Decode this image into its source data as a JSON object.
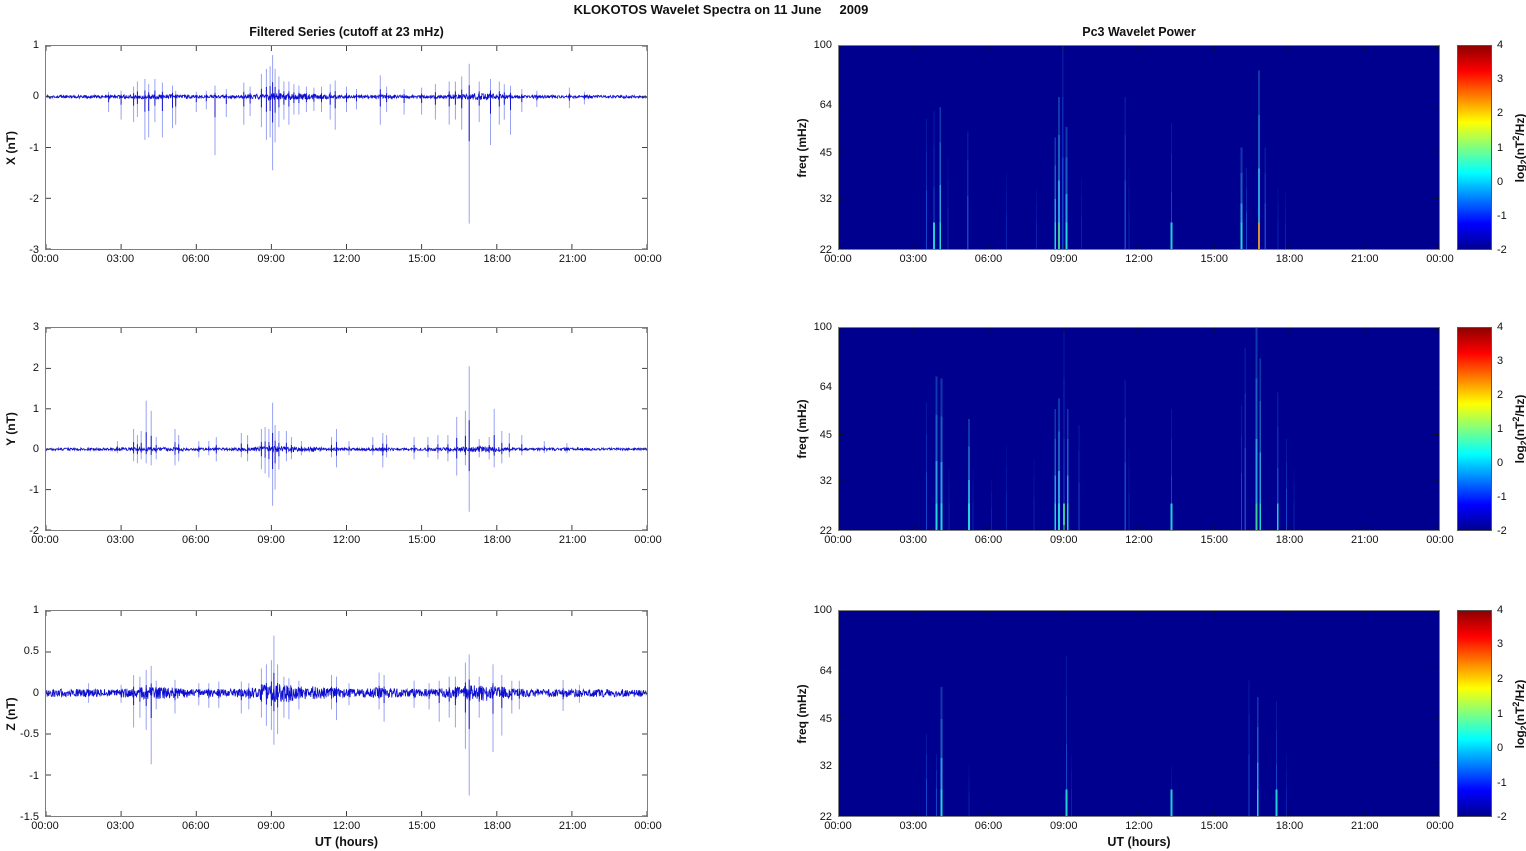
{
  "figure_title": "KLOKOTOS Wavelet Spectra on 11 June     2009",
  "colorbar": {
    "ticks": [
      4,
      3,
      2,
      1,
      0,
      -1,
      -2
    ],
    "range": [
      -2,
      4
    ],
    "label_prefix": "log",
    "label_sub": "2",
    "label_mid": "(nT",
    "label_sup": "2",
    "label_suffix": "/Hz)",
    "jet_stops": [
      [
        "#000090",
        0
      ],
      [
        "#0000ff",
        12.5
      ],
      [
        "#00ffff",
        37.5
      ],
      [
        "#ffff00",
        62.5
      ],
      [
        "#ff0000",
        87.5
      ],
      [
        "#900000",
        100
      ]
    ]
  },
  "chart_data": [
    {
      "type": "line",
      "title": "Filtered Series (cutoff at 23 mHz)",
      "ylabel": "X (nT)",
      "xlabel": "",
      "x_ticks": [
        "00:00",
        "03:00",
        "06:00",
        "09:00",
        "12:00",
        "15:00",
        "18:00",
        "21:00",
        "00:00"
      ],
      "x_range_hours": [
        0,
        24
      ],
      "y_ticks": [
        1,
        0,
        -1,
        -2,
        -3
      ],
      "ylim": [
        -3,
        1
      ],
      "line_color": "#0000cc",
      "spike_color": "#4658e8",
      "noise_amplitude": 0.03,
      "spikes": [
        [
          2.5,
          0.1,
          -0.3
        ],
        [
          3.0,
          0.12,
          -0.45
        ],
        [
          3.5,
          0.2,
          -0.5
        ],
        [
          3.65,
          0.3,
          -0.4
        ],
        [
          3.95,
          0.35,
          -0.85
        ],
        [
          4.1,
          0.25,
          -0.8
        ],
        [
          4.35,
          0.35,
          -0.5
        ],
        [
          4.65,
          0.28,
          -0.8
        ],
        [
          5.05,
          0.22,
          -0.62
        ],
        [
          5.18,
          0.12,
          -0.55
        ],
        [
          6.0,
          0.1,
          -0.3
        ],
        [
          6.4,
          0.12,
          -0.25
        ],
        [
          6.75,
          0.22,
          -1.15
        ],
        [
          7.2,
          0.15,
          -0.4
        ],
        [
          7.9,
          0.28,
          -0.55
        ],
        [
          8.15,
          0.2,
          -0.38
        ],
        [
          8.6,
          0.45,
          -0.6
        ],
        [
          8.8,
          0.55,
          -0.85
        ],
        [
          8.95,
          0.6,
          -0.8
        ],
        [
          9.05,
          0.82,
          -1.45
        ],
        [
          9.15,
          0.55,
          -0.9
        ],
        [
          9.3,
          0.4,
          -0.6
        ],
        [
          9.5,
          0.3,
          -0.45
        ],
        [
          9.7,
          0.3,
          -0.55
        ],
        [
          9.9,
          0.25,
          -0.35
        ],
        [
          10.1,
          0.22,
          -0.35
        ],
        [
          10.4,
          0.2,
          -0.3
        ],
        [
          10.7,
          0.18,
          -0.28
        ],
        [
          11.0,
          0.2,
          -0.3
        ],
        [
          11.35,
          0.25,
          -0.45
        ],
        [
          11.55,
          0.32,
          -0.65
        ],
        [
          12.0,
          0.2,
          -0.3
        ],
        [
          12.4,
          0.15,
          -0.25
        ],
        [
          13.35,
          0.42,
          -0.55
        ],
        [
          13.6,
          0.2,
          -0.3
        ],
        [
          14.3,
          0.15,
          -0.35
        ],
        [
          15.0,
          0.18,
          -0.35
        ],
        [
          15.55,
          0.25,
          -0.45
        ],
        [
          16.1,
          0.3,
          -0.55
        ],
        [
          16.35,
          0.3,
          -0.45
        ],
        [
          16.6,
          0.4,
          -0.65
        ],
        [
          16.9,
          0.65,
          -2.5
        ],
        [
          17.3,
          0.3,
          -0.5
        ],
        [
          17.75,
          0.35,
          -0.95
        ],
        [
          18.1,
          0.3,
          -0.55
        ],
        [
          18.3,
          0.25,
          -0.45
        ],
        [
          18.55,
          0.22,
          -0.75
        ],
        [
          19.0,
          0.15,
          -0.3
        ],
        [
          19.6,
          0.12,
          -0.2
        ],
        [
          20.9,
          0.18,
          -0.22
        ],
        [
          21.5,
          0.1,
          -0.15
        ]
      ]
    },
    {
      "type": "heatmap",
      "title": "Pc3 Wavelet Power",
      "ylabel": "freq (mHz)",
      "xlabel": "",
      "x_ticks": [
        "00:00",
        "03:00",
        "06:00",
        "09:00",
        "12:00",
        "15:00",
        "18:00",
        "21:00",
        "00:00"
      ],
      "x_range_hours": [
        0,
        24
      ],
      "y_ticks": [
        100,
        64,
        45,
        32,
        22
      ],
      "ylim_mhz": [
        22,
        100
      ],
      "y_scale": "log",
      "bg_color": "#00008f",
      "colorbar_range": [
        -2,
        4
      ],
      "streaks": [
        [
          3.5,
          0.64,
          1,
          ""
        ],
        [
          3.8,
          0.68,
          1,
          "cyan"
        ],
        [
          4.05,
          0.7,
          2,
          "cyan"
        ],
        [
          4.35,
          0.45,
          0,
          ""
        ],
        [
          5.15,
          0.58,
          1,
          ""
        ],
        [
          6.7,
          0.38,
          0,
          ""
        ],
        [
          7.9,
          0.3,
          0,
          ""
        ],
        [
          8.65,
          0.55,
          2,
          "cyan"
        ],
        [
          8.8,
          0.75,
          2,
          "green"
        ],
        [
          8.95,
          1.0,
          1,
          ""
        ],
        [
          9.1,
          0.6,
          2,
          "cyan"
        ],
        [
          9.7,
          0.35,
          0,
          ""
        ],
        [
          11.45,
          0.75,
          1,
          ""
        ],
        [
          11.6,
          0.4,
          0,
          ""
        ],
        [
          13.3,
          0.62,
          1,
          "cyan"
        ],
        [
          16.1,
          0.5,
          2,
          "cyan"
        ],
        [
          16.3,
          0.4,
          1,
          ""
        ],
        [
          16.8,
          0.88,
          2,
          "orange"
        ],
        [
          17.05,
          0.5,
          1,
          ""
        ],
        [
          17.55,
          0.3,
          0,
          ""
        ],
        [
          17.85,
          0.28,
          0,
          ""
        ]
      ]
    },
    {
      "type": "line",
      "title": "",
      "ylabel": "Y (nT)",
      "xlabel": "",
      "x_ticks": [
        "00:00",
        "03:00",
        "06:00",
        "09:00",
        "12:00",
        "15:00",
        "18:00",
        "21:00",
        "00:00"
      ],
      "x_range_hours": [
        0,
        24
      ],
      "y_ticks": [
        3,
        2,
        1,
        0,
        -1,
        -2
      ],
      "ylim": [
        -2,
        3
      ],
      "line_color": "#0000cc",
      "spike_color": "#4658e8",
      "noise_amplitude": 0.032,
      "spikes": [
        [
          2.85,
          0.2,
          -0.1
        ],
        [
          3.5,
          0.5,
          -0.3
        ],
        [
          3.65,
          0.35,
          -0.35
        ],
        [
          3.8,
          0.45,
          -0.25
        ],
        [
          4.0,
          1.2,
          -0.35
        ],
        [
          4.2,
          0.95,
          -0.4
        ],
        [
          4.4,
          0.3,
          -0.25
        ],
        [
          5.15,
          0.5,
          -0.4
        ],
        [
          5.3,
          0.35,
          -0.3
        ],
        [
          6.1,
          0.2,
          -0.2
        ],
        [
          6.5,
          0.2,
          -0.15
        ],
        [
          6.8,
          0.3,
          -0.3
        ],
        [
          7.8,
          0.4,
          -0.2
        ],
        [
          8.05,
          0.35,
          -0.3
        ],
        [
          8.6,
          0.5,
          -0.5
        ],
        [
          8.75,
          0.55,
          -0.6
        ],
        [
          8.9,
          0.5,
          -0.7
        ],
        [
          9.05,
          1.15,
          -1.4
        ],
        [
          9.15,
          0.6,
          -1.0
        ],
        [
          9.3,
          0.45,
          -0.5
        ],
        [
          9.6,
          0.45,
          -0.3
        ],
        [
          9.8,
          0.3,
          -0.25
        ],
        [
          10.2,
          0.2,
          -0.15
        ],
        [
          11.4,
          0.3,
          -0.2
        ],
        [
          11.6,
          0.5,
          -0.45
        ],
        [
          12.1,
          0.2,
          -0.15
        ],
        [
          13.05,
          0.3,
          -0.15
        ],
        [
          13.45,
          0.4,
          -0.45
        ],
        [
          13.6,
          0.35,
          -0.2
        ],
        [
          14.7,
          0.3,
          -0.25
        ],
        [
          15.25,
          0.3,
          -0.2
        ],
        [
          15.65,
          0.35,
          -0.25
        ],
        [
          16.05,
          0.35,
          -0.3
        ],
        [
          16.4,
          0.8,
          -0.65
        ],
        [
          16.75,
          0.95,
          -0.4
        ],
        [
          16.9,
          2.05,
          -1.55
        ],
        [
          17.3,
          0.25,
          -0.2
        ],
        [
          17.7,
          0.3,
          -0.25
        ],
        [
          17.9,
          1.0,
          -0.45
        ],
        [
          18.2,
          0.45,
          -0.35
        ],
        [
          18.5,
          0.4,
          -0.2
        ],
        [
          19.0,
          0.35,
          -0.15
        ],
        [
          19.9,
          0.2,
          -0.1
        ],
        [
          20.8,
          0.15,
          -0.1
        ]
      ]
    },
    {
      "type": "heatmap",
      "title": "",
      "ylabel": "freq (mHz)",
      "xlabel": "",
      "x_ticks": [
        "00:00",
        "03:00",
        "06:00",
        "09:00",
        "12:00",
        "15:00",
        "18:00",
        "21:00",
        "00:00"
      ],
      "x_range_hours": [
        0,
        24
      ],
      "y_ticks": [
        100,
        64,
        45,
        32,
        22
      ],
      "ylim_mhz": [
        22,
        100
      ],
      "y_scale": "log",
      "bg_color": "#00008f",
      "colorbar_range": [
        -2,
        4
      ],
      "streaks": [
        [
          3.5,
          0.63,
          1,
          ""
        ],
        [
          3.9,
          0.76,
          2,
          "cyan"
        ],
        [
          4.1,
          0.75,
          2,
          "cyan"
        ],
        [
          4.4,
          0.3,
          0,
          ""
        ],
        [
          5.2,
          0.55,
          2,
          "cyan"
        ],
        [
          5.35,
          0.3,
          0,
          ""
        ],
        [
          6.1,
          0.25,
          0,
          ""
        ],
        [
          6.7,
          0.42,
          0,
          ""
        ],
        [
          7.8,
          0.35,
          0,
          ""
        ],
        [
          8.65,
          0.6,
          2,
          "cyan"
        ],
        [
          8.8,
          0.65,
          2,
          "cyan"
        ],
        [
          9.0,
          1.0,
          1,
          "green"
        ],
        [
          9.15,
          0.6,
          2,
          "cyan"
        ],
        [
          9.6,
          0.52,
          1,
          ""
        ],
        [
          11.45,
          0.74,
          1,
          ""
        ],
        [
          11.6,
          0.4,
          0,
          ""
        ],
        [
          13.3,
          0.6,
          1,
          "cyan"
        ],
        [
          16.1,
          0.62,
          1,
          ""
        ],
        [
          16.25,
          0.9,
          1,
          ""
        ],
        [
          16.7,
          1.0,
          2,
          "green"
        ],
        [
          16.85,
          0.85,
          2,
          "cyan"
        ],
        [
          17.55,
          0.68,
          1,
          "cyan"
        ],
        [
          17.9,
          0.45,
          1,
          ""
        ],
        [
          18.2,
          0.3,
          0,
          ""
        ]
      ]
    },
    {
      "type": "line",
      "title": "",
      "ylabel": "Z (nT)",
      "xlabel": "UT (hours)",
      "x_ticks": [
        "00:00",
        "03:00",
        "06:00",
        "09:00",
        "12:00",
        "15:00",
        "18:00",
        "21:00",
        "00:00"
      ],
      "x_range_hours": [
        0,
        24
      ],
      "y_ticks": [
        1,
        0.5,
        0,
        -0.5,
        -1,
        -1.5
      ],
      "ylim": [
        -1.5,
        1
      ],
      "line_color": "#0000cc",
      "spike_color": "#4658e8",
      "noise_amplitude": 0.048,
      "spikes": [
        [
          1.7,
          0.12,
          -0.12
        ],
        [
          3.0,
          0.1,
          -0.12
        ],
        [
          3.5,
          0.22,
          -0.42
        ],
        [
          3.75,
          0.2,
          -0.3
        ],
        [
          4.0,
          0.28,
          -0.45
        ],
        [
          4.2,
          0.33,
          -0.87
        ],
        [
          4.4,
          0.15,
          -0.2
        ],
        [
          5.15,
          0.16,
          -0.25
        ],
        [
          6.1,
          0.12,
          -0.15
        ],
        [
          6.5,
          0.12,
          -0.18
        ],
        [
          6.9,
          0.14,
          -0.18
        ],
        [
          7.8,
          0.14,
          -0.25
        ],
        [
          8.1,
          0.12,
          -0.2
        ],
        [
          8.6,
          0.3,
          -0.3
        ],
        [
          8.8,
          0.35,
          -0.4
        ],
        [
          9.0,
          0.4,
          -0.45
        ],
        [
          9.1,
          0.7,
          -0.63
        ],
        [
          9.25,
          0.35,
          -0.5
        ],
        [
          9.5,
          0.2,
          -0.3
        ],
        [
          9.7,
          0.18,
          -0.32
        ],
        [
          10.1,
          0.15,
          -0.2
        ],
        [
          11.4,
          0.22,
          -0.2
        ],
        [
          11.6,
          0.2,
          -0.33
        ],
        [
          12.1,
          0.12,
          -0.15
        ],
        [
          13.3,
          0.25,
          -0.2
        ],
        [
          13.5,
          0.22,
          -0.35
        ],
        [
          14.7,
          0.15,
          -0.18
        ],
        [
          15.3,
          0.12,
          -0.2
        ],
        [
          15.7,
          0.15,
          -0.35
        ],
        [
          16.1,
          0.2,
          -0.3
        ],
        [
          16.35,
          0.2,
          -0.42
        ],
        [
          16.75,
          0.37,
          -0.68
        ],
        [
          16.9,
          0.47,
          -1.25
        ],
        [
          17.3,
          0.2,
          -0.3
        ],
        [
          17.85,
          0.35,
          -0.72
        ],
        [
          18.2,
          0.22,
          -0.52
        ],
        [
          18.6,
          0.15,
          -0.25
        ],
        [
          18.9,
          0.15,
          -0.2
        ],
        [
          20.65,
          0.16,
          -0.22
        ],
        [
          21.3,
          0.1,
          -0.12
        ]
      ]
    },
    {
      "type": "heatmap",
      "title": "",
      "ylabel": "freq (mHz)",
      "xlabel": "UT (hours)",
      "x_ticks": [
        "00:00",
        "03:00",
        "06:00",
        "09:00",
        "12:00",
        "15:00",
        "18:00",
        "21:00",
        "00:00"
      ],
      "x_range_hours": [
        0,
        24
      ],
      "y_ticks": [
        100,
        64,
        45,
        32,
        22
      ],
      "ylim_mhz": [
        22,
        100
      ],
      "y_scale": "log",
      "bg_color": "#00008f",
      "colorbar_range": [
        -2,
        4
      ],
      "streaks": [
        [
          3.5,
          0.4,
          1,
          ""
        ],
        [
          3.9,
          0.3,
          1,
          ""
        ],
        [
          4.1,
          0.63,
          2,
          "cyan"
        ],
        [
          5.2,
          0.25,
          0,
          ""
        ],
        [
          9.1,
          0.78,
          1,
          "cyan"
        ],
        [
          9.3,
          0.3,
          0,
          ""
        ],
        [
          13.3,
          0.25,
          0,
          "cyan"
        ],
        [
          16.4,
          0.66,
          1,
          ""
        ],
        [
          16.75,
          0.58,
          2,
          "cyan"
        ],
        [
          17.5,
          0.56,
          1,
          "cyan"
        ],
        [
          17.9,
          0.3,
          0,
          ""
        ]
      ]
    }
  ]
}
